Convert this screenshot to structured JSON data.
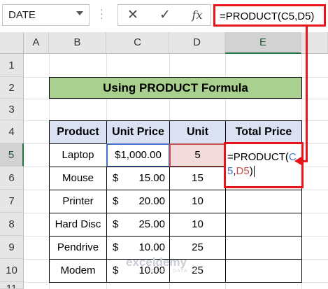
{
  "formula_bar": {
    "name_box": "DATE",
    "cancel_icon": "✕",
    "enter_icon": "✓",
    "fx_label": "fx",
    "formula": "=PRODUCT(C5,D5)"
  },
  "columns": [
    "A",
    "B",
    "C",
    "D",
    "E"
  ],
  "rows": [
    "1",
    "2",
    "3",
    "4",
    "5",
    "6",
    "7",
    "8",
    "9",
    "10",
    "11"
  ],
  "title": "Using PRODUCT Formula",
  "table": {
    "headers": [
      "Product",
      "Unit Price",
      "Unit",
      "Total Price"
    ],
    "rows": [
      {
        "product": "Laptop",
        "currency": "$1,000.00",
        "unit": "5"
      },
      {
        "product": "Mouse",
        "currency": "$",
        "amount": "15.00",
        "unit": "15"
      },
      {
        "product": "Printer",
        "currency": "$",
        "amount": "20.00",
        "unit": "10"
      },
      {
        "product": "Hard Disc",
        "currency": "$",
        "amount": "25.00",
        "unit": "10"
      },
      {
        "product": "Pendrive",
        "currency": "$",
        "amount": "10.00",
        "unit": "25"
      },
      {
        "product": "Modem",
        "currency": "$",
        "amount": "10.00",
        "unit": "25"
      }
    ],
    "editing": {
      "prefix": "=PRODUCT(",
      "ref1": "C5",
      "sep": ",",
      "ref2": "D5",
      "suffix": ")"
    }
  },
  "watermark": {
    "name": "exceldemy",
    "tagline": "EXCEL · DATA · BI"
  },
  "colors": {
    "accent_red": "#e8141b",
    "ref_blue": "#4472c4",
    "ref_red": "#c0504d",
    "title_green": "#a9d08e",
    "header_blue": "#d9e1f2"
  }
}
